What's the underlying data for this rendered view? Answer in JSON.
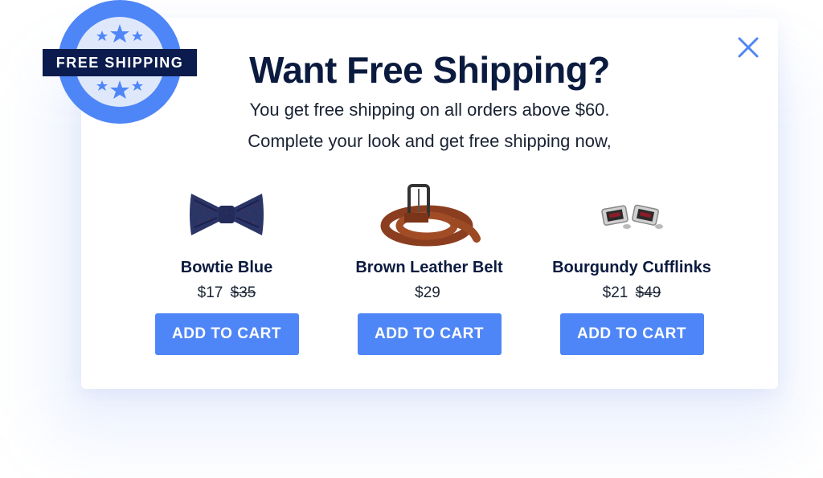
{
  "popup": {
    "headline": "Want Free Shipping?",
    "subline_1": "You get free shipping on all orders above $60.",
    "subline_2": "Complete your look and get free shipping now,",
    "close_icon": "close-icon"
  },
  "badge": {
    "label": "FREE SHIPPING",
    "icon": "star-badge-icon"
  },
  "products": [
    {
      "name": "Bowtie Blue",
      "price": "$17",
      "old_price": "$35",
      "image": "bowtie-image",
      "button": "ADD TO CART"
    },
    {
      "name": "Brown Leather Belt",
      "price": "$29",
      "old_price": "",
      "image": "belt-image",
      "button": "ADD TO CART"
    },
    {
      "name": "Bourgundy Cufflinks",
      "price": "$21",
      "old_price": "$49",
      "image": "cufflinks-image",
      "button": "ADD TO CART"
    }
  ],
  "colors": {
    "accent": "#4f86f7",
    "heading": "#0b1b3f",
    "badge_dark": "#0b1b4d"
  }
}
